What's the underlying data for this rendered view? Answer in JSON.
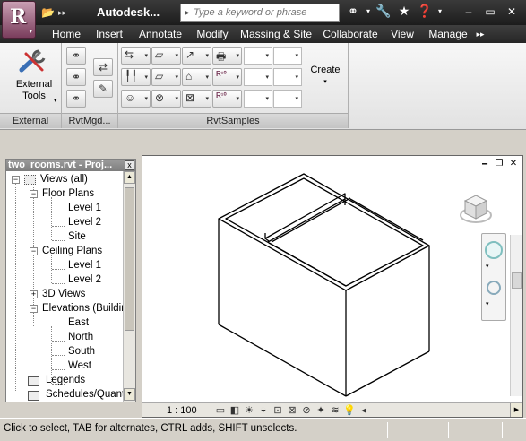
{
  "window": {
    "title": "Autodesk...",
    "minimize": "–",
    "maximize": "▭",
    "close": "✕"
  },
  "app_button": {
    "letter": "R",
    "menu_arrow": "▾"
  },
  "search": {
    "placeholder": "Type a keyword or phrase"
  },
  "ribbon_tabs": [
    {
      "label": "Home"
    },
    {
      "label": "Insert"
    },
    {
      "label": "Annotate"
    },
    {
      "label": "Modify"
    },
    {
      "label": "Massing & Site"
    },
    {
      "label": "Collaborate"
    },
    {
      "label": "View"
    },
    {
      "label": "Manage"
    },
    {
      "label": "▸▸"
    }
  ],
  "ribbon": {
    "external_tools_line1": "External",
    "external_tools_line2": "Tools",
    "panels": {
      "external": "External",
      "rvtmgd": "RvtMgd...",
      "rvtsamples": "RvtSamples"
    },
    "create_label": "Create"
  },
  "project_browser": {
    "title": "two_rooms.rvt - Proj...",
    "close": "x",
    "tree": {
      "views_all": "Views (all)",
      "floor_plans": "Floor Plans",
      "fp_level1": "Level 1",
      "fp_level2": "Level 2",
      "fp_site": "Site",
      "ceiling_plans": "Ceiling Plans",
      "cp_level1": "Level 1",
      "cp_level2": "Level 2",
      "views_3d": "3D Views",
      "elevations": "Elevations (Building Elevation)",
      "east": "East",
      "north": "North",
      "south": "South",
      "west": "West",
      "legends": "Legends",
      "schedules": "Schedules/Quantities"
    }
  },
  "view": {
    "scale": "1 : 100"
  },
  "status": {
    "text": "Click to select, TAB for alternates, CTRL adds, SHIFT unselects."
  },
  "colors": {
    "title_bar": "#262626",
    "ribbon_tabs": "#333333",
    "app_button": "#9a5577",
    "workspace": "#d4d0c8"
  }
}
